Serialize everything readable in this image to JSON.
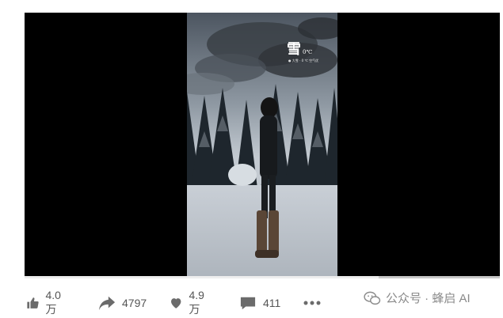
{
  "video": {
    "overlay_title": "雪",
    "overlay_temp": "0℃",
    "overlay_location": "● 大雪 · 0 ℃  空气优"
  },
  "actions": {
    "like_count": "4.0万",
    "share_count": "4797",
    "favorite_count": "4.9万",
    "comment_count": "411"
  },
  "watermark": {
    "text": "公众号 · 蜂启 AI"
  },
  "colors": {
    "action_icon": "#6b6b6b",
    "player_bg": "#000000"
  }
}
